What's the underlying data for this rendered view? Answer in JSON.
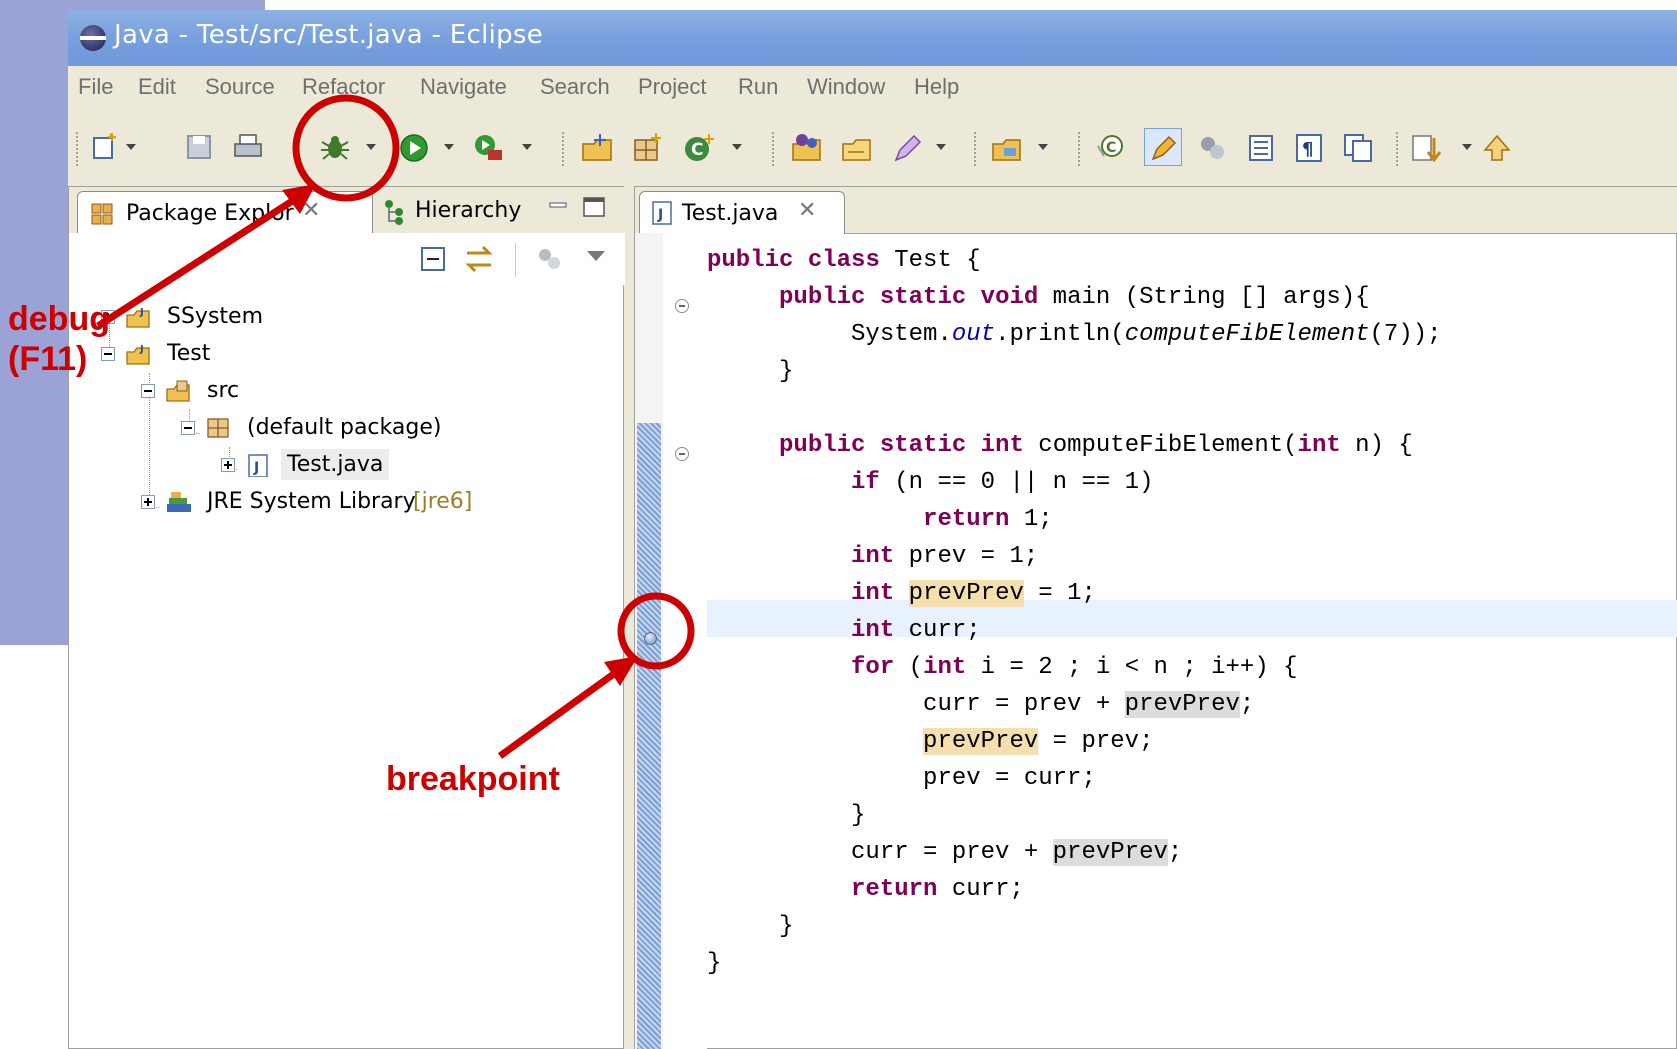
{
  "window": {
    "title": "Java - Test/src/Test.java - Eclipse"
  },
  "menu": [
    "File",
    "Edit",
    "Source",
    "Refactor",
    "Navigate",
    "Search",
    "Project",
    "Run",
    "Window",
    "Help"
  ],
  "explorer": {
    "tabs": [
      {
        "label": "Package Explor"
      },
      {
        "label": "Hierarchy"
      }
    ],
    "tree": [
      {
        "label": "SSystem"
      },
      {
        "label": "Test"
      },
      {
        "label": "src"
      },
      {
        "label": "(default package)"
      },
      {
        "label": "Test.java"
      },
      {
        "label": "JRE System Library",
        "suffix": "[jre6]"
      }
    ]
  },
  "editor": {
    "tab": {
      "label": "Test.java"
    }
  },
  "annotations": {
    "debug": [
      "debug",
      "(F11)"
    ],
    "breakpoint": "breakpoint"
  },
  "colors": {
    "annotation": "#cc0000",
    "keyword": "#7f0055",
    "field": "#0000c0",
    "titlebar": "#7aa1de",
    "current_line": "#e8f2fe",
    "occurrence": "#f5dfae"
  }
}
